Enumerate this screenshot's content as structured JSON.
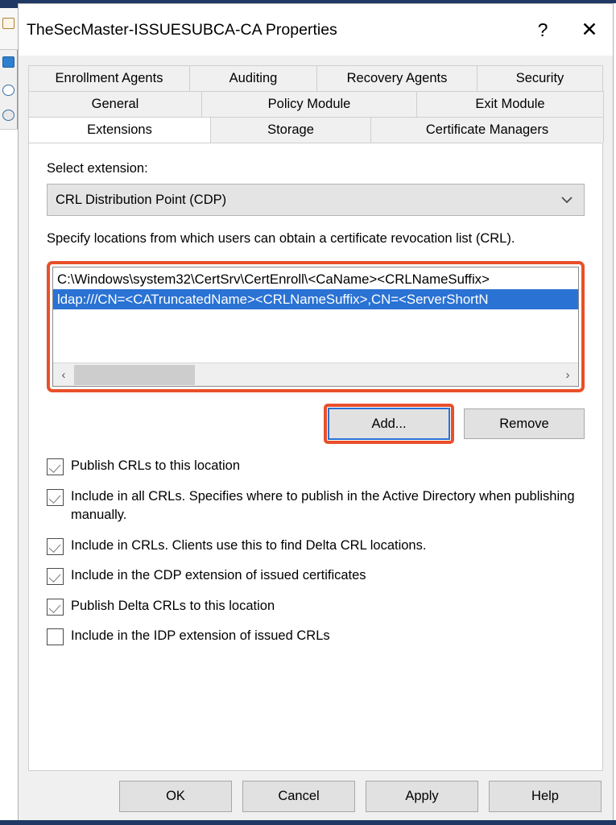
{
  "window": {
    "title": "TheSecMaster-ISSUESUBCA-CA Properties",
    "help_glyph": "?",
    "close_glyph": "✕"
  },
  "tabs": {
    "row1": [
      {
        "label": "Enrollment Agents",
        "active": false
      },
      {
        "label": "Auditing",
        "active": false
      },
      {
        "label": "Recovery Agents",
        "active": false
      },
      {
        "label": "Security",
        "active": false
      }
    ],
    "row2": [
      {
        "label": "General",
        "active": false
      },
      {
        "label": "Policy Module",
        "active": false
      },
      {
        "label": "Exit Module",
        "active": false
      }
    ],
    "row3": [
      {
        "label": "Extensions",
        "active": true
      },
      {
        "label": "Storage",
        "active": false
      },
      {
        "label": "Certificate Managers",
        "active": false
      }
    ]
  },
  "extensions_tab": {
    "select_extension_label": "Select extension:",
    "extension_dropdown": {
      "value": "CRL Distribution Point (CDP)",
      "chevron": "⌄"
    },
    "description": "Specify locations from which users can obtain a certificate revocation list (CRL).",
    "locations": [
      {
        "path": "C:\\Windows\\system32\\CertSrv\\CertEnroll\\<CaName><CRLNameSuffix>",
        "selected": false
      },
      {
        "path": "ldap:///CN=<CATruncatedName><CRLNameSuffix>,CN=<ServerShortN",
        "selected": true
      }
    ],
    "scrollbar": {
      "left_arrow": "‹",
      "right_arrow": "›"
    },
    "add_button": "Add...",
    "remove_button": "Remove",
    "checkboxes": [
      {
        "label": "Publish CRLs to this location",
        "checked": true
      },
      {
        "label": "Include in all CRLs. Specifies where to publish in the Active Directory when publishing manually.",
        "checked": true
      },
      {
        "label": "Include in CRLs. Clients use this to find Delta CRL locations.",
        "checked": true
      },
      {
        "label": "Include in the CDP extension of issued certificates",
        "checked": true
      },
      {
        "label": "Publish Delta CRLs to this location",
        "checked": true
      },
      {
        "label": "Include in the IDP extension of issued CRLs",
        "checked": false
      }
    ]
  },
  "footer": {
    "ok": "OK",
    "cancel": "Cancel",
    "apply": "Apply",
    "help": "Help"
  },
  "colors": {
    "annotation_highlight": "#E8502A",
    "selection_blue": "#2A72D4",
    "dialog_background": "#F0F0F0",
    "panel_background": "#FFFFFF",
    "titlebar_accent": "#1F3864"
  }
}
